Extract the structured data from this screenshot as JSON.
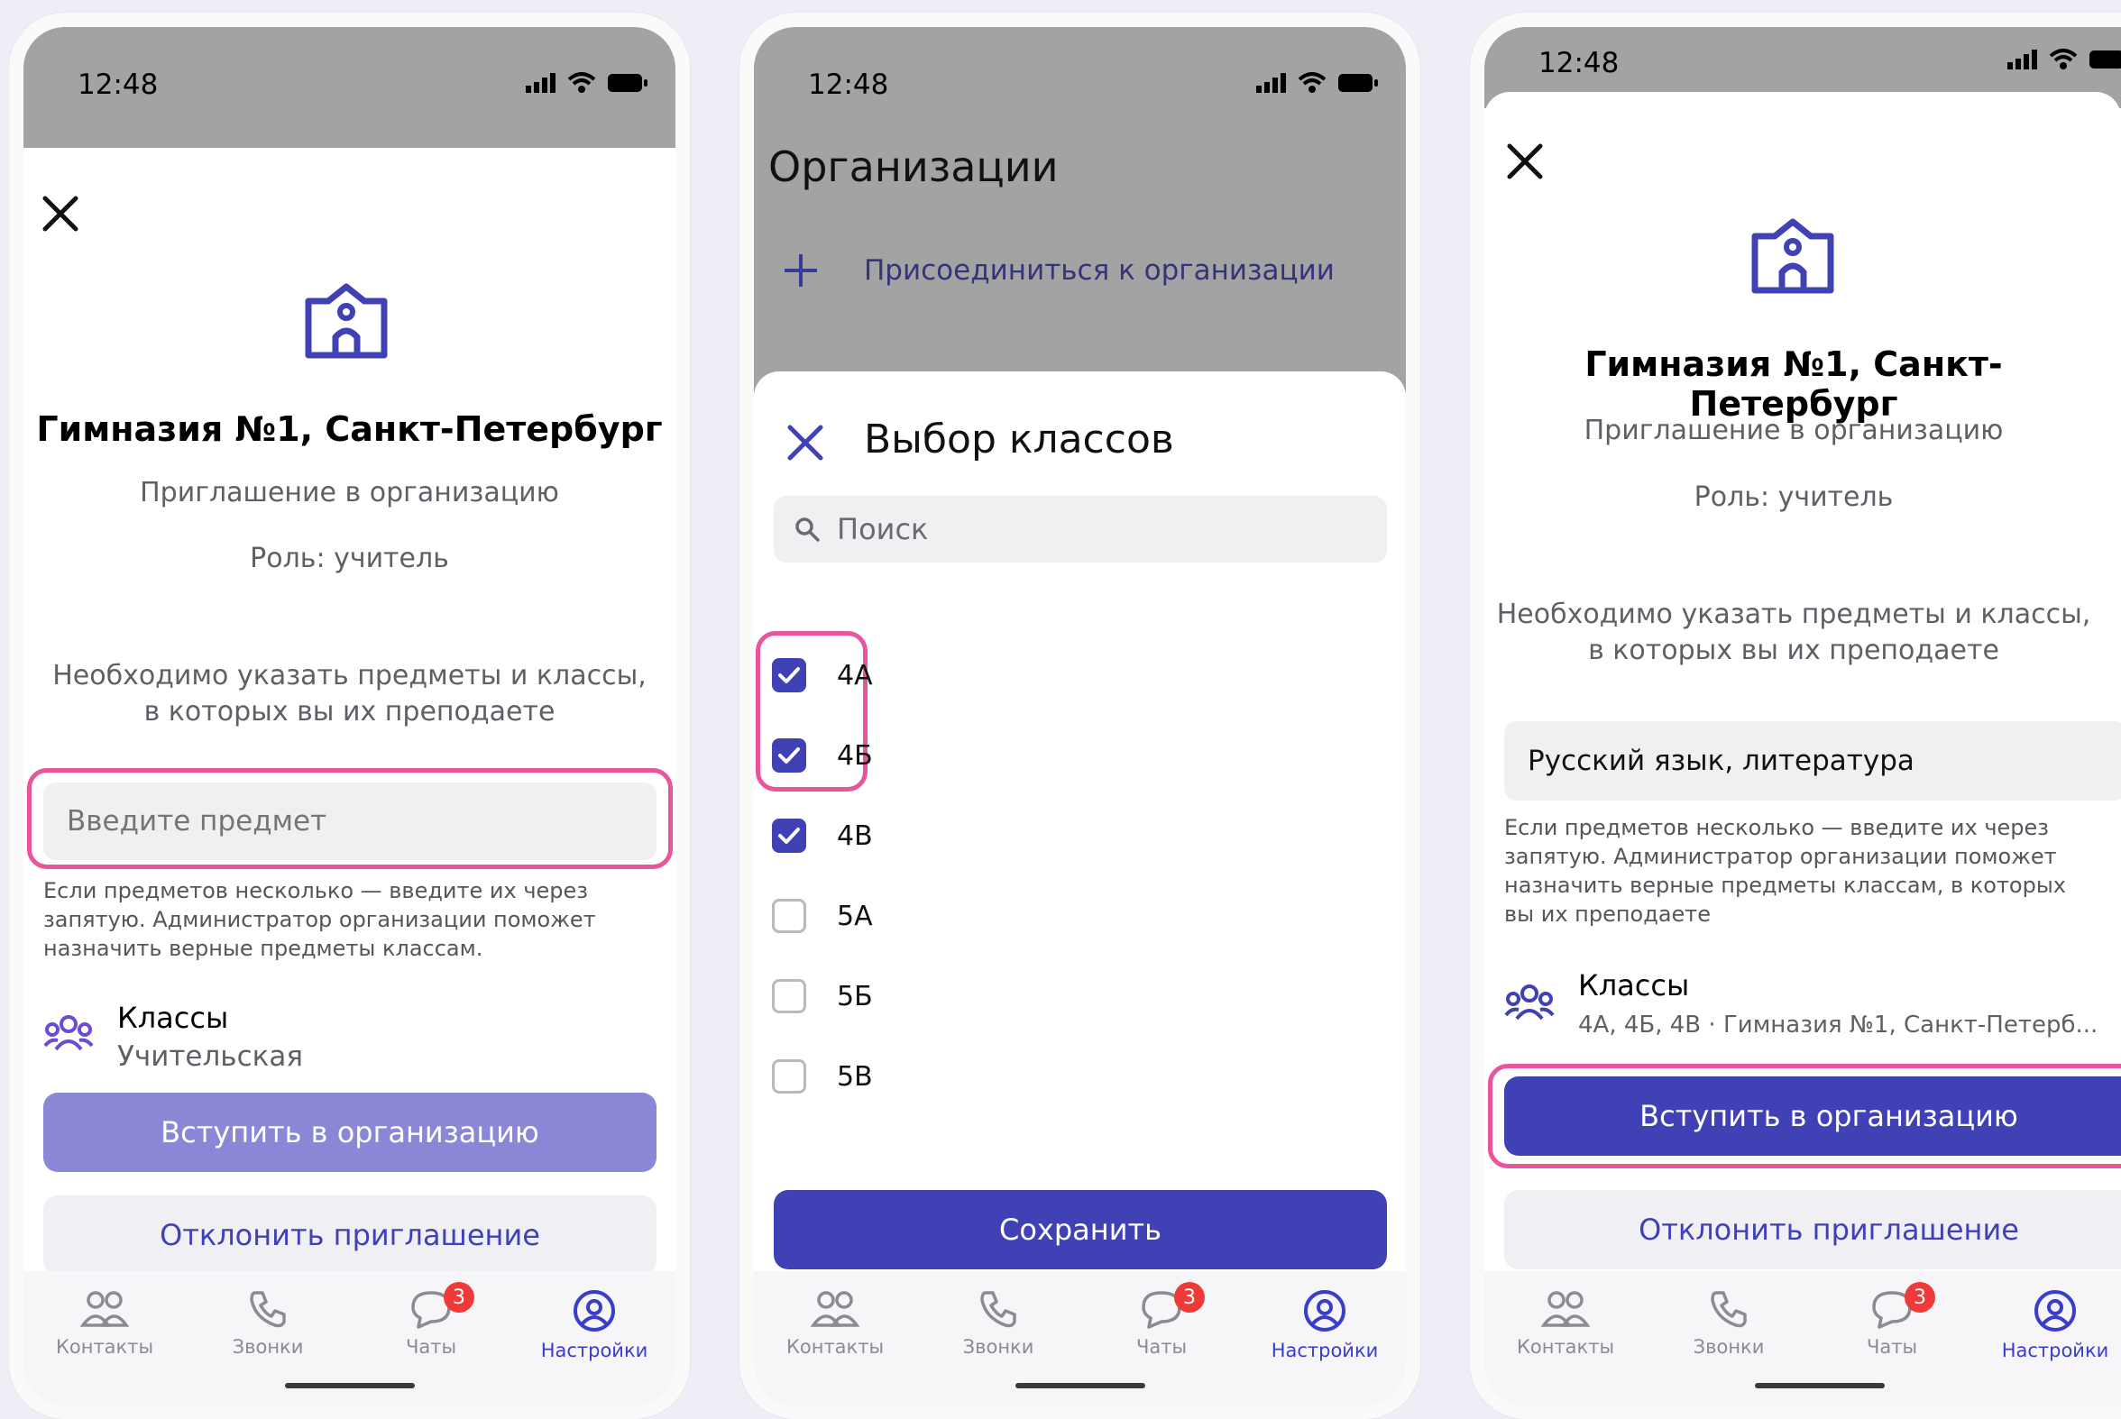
{
  "status": {
    "time": "12:48"
  },
  "colors": {
    "accent": "#4041b5",
    "accent_disabled": "#8a88d6",
    "highlight": "#e8559a",
    "badge": "#f03a3a"
  },
  "invite": {
    "org_name": "Гимназия №1, Санкт-Петербург",
    "subtitle": "Приглашение в организацию",
    "role": "Роль: учитель",
    "instruction_line1": "Необходимо указать предметы и классы,",
    "instruction_line2": "в которых вы их преподаете"
  },
  "screen1": {
    "subject_placeholder": "Введите предмет",
    "note_line1": "Если предметов несколько — введите их через",
    "note_line2": "запятую. Администратор организации поможет",
    "note_line3": "назначить верные предметы классам.",
    "classes_title": "Классы",
    "classes_value": "Учительская",
    "join_label": "Вступить в организацию",
    "decline_label": "Отклонить приглашение"
  },
  "screen2": {
    "bg_title": "Организации",
    "join_org_link": "Присоединиться к организации",
    "sheet_title": "Выбор классов",
    "search_placeholder": "Поиск",
    "classes": [
      {
        "label": "4А",
        "checked": true
      },
      {
        "label": "4Б",
        "checked": true
      },
      {
        "label": "4В",
        "checked": true
      },
      {
        "label": "5А",
        "checked": false
      },
      {
        "label": "5Б",
        "checked": false
      },
      {
        "label": "5В",
        "checked": false
      }
    ],
    "save_label": "Сохранить"
  },
  "screen3": {
    "subject_value": "Русский язык, литература",
    "note_line1": "Если предметов несколько — введите их через",
    "note_line2": "запятую. Администратор организации поможет",
    "note_line3": "назначить верные предметы классам, в которых",
    "note_line4": "вы их преподаете",
    "classes_title": "Классы",
    "classes_value": "4А, 4Б, 4В · Гимназия №1, Санкт-Петерб...",
    "join_label": "Вступить в организацию",
    "decline_label": "Отклонить приглашение"
  },
  "tabs": [
    {
      "label": "Контакты",
      "icon": "contacts-icon"
    },
    {
      "label": "Звонки",
      "icon": "phone-icon"
    },
    {
      "label": "Чаты",
      "icon": "chat-icon",
      "badge": "3"
    },
    {
      "label": "Настройки",
      "icon": "profile-icon",
      "active": true
    }
  ]
}
